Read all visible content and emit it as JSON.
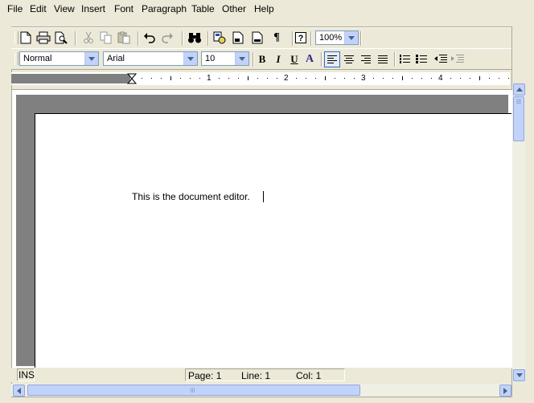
{
  "menu": [
    "File",
    "Edit",
    "View",
    "Insert",
    "Font",
    "Paragraph",
    "Table",
    "Other",
    "Help"
  ],
  "toolbar_standard": {
    "zoom_value": "100%"
  },
  "toolbar_format": {
    "style_value": "Normal",
    "font_value": "Arial",
    "size_value": "10",
    "bold_label": "B",
    "italic_label": "I",
    "underline_label": "U",
    "font_color_label": "A"
  },
  "ruler": {
    "numbers": [
      "1",
      "2",
      "3",
      "4"
    ]
  },
  "document": {
    "text": "This is the document editor."
  },
  "status": {
    "mode": "INS",
    "page": "Page: 1",
    "line": "Line: 1",
    "col": "Col: 1"
  },
  "colors": {
    "chrome": "#ece9d8",
    "scroll_accent": "#c1d3fb",
    "page_background_gray": "#808080"
  }
}
